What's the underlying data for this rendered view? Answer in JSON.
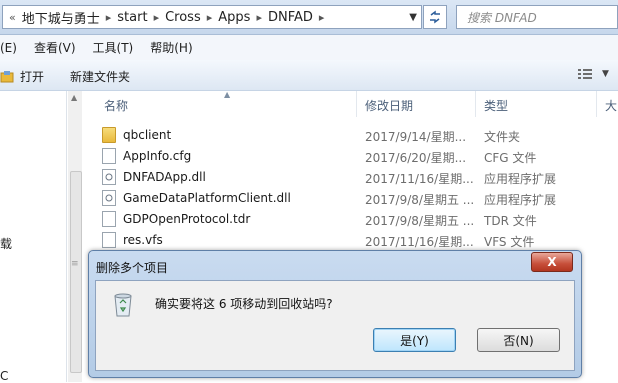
{
  "address": {
    "breadcrumbs": [
      "地下城与勇士",
      "start",
      "Cross",
      "Apps",
      "DNFAD"
    ],
    "search_placeholder": "搜索 DNFAD"
  },
  "menu": [
    "(E)",
    "查看(V)",
    "工具(T)",
    "帮助(H)"
  ],
  "toolbar": {
    "open_label": "打开",
    "new_folder_label": "新建文件夹"
  },
  "nav_pane": {
    "label_1": "载",
    "label_2": "C"
  },
  "columns": {
    "name": "名称",
    "date": "修改日期",
    "type": "类型",
    "size": "大"
  },
  "files": [
    {
      "name": "qbclient",
      "date": "2017/9/14/星期...",
      "type": "文件夹",
      "icon": "folder-icon"
    },
    {
      "name": "AppInfo.cfg",
      "date": "2017/6/20/星期...",
      "type": "CFG 文件",
      "icon": "file-icon"
    },
    {
      "name": "DNFADApp.dll",
      "date": "2017/11/16/星期...",
      "type": "应用程序扩展",
      "icon": "dll-icon"
    },
    {
      "name": "GameDataPlatformClient.dll",
      "date": "2017/9/8/星期五 ...",
      "type": "应用程序扩展",
      "icon": "dll-icon"
    },
    {
      "name": "GDPOpenProtocol.tdr",
      "date": "2017/9/8/星期五 ...",
      "type": "TDR 文件",
      "icon": "file-icon"
    },
    {
      "name": "res.vfs",
      "date": "2017/11/16/星期...",
      "type": "VFS 文件",
      "icon": "file-icon"
    }
  ],
  "dialog": {
    "title": "删除多个项目",
    "close": "X",
    "message": "确实要将这 6 项移动到回收站吗?",
    "yes_label": "是(Y)",
    "no_label": "否(N)"
  }
}
